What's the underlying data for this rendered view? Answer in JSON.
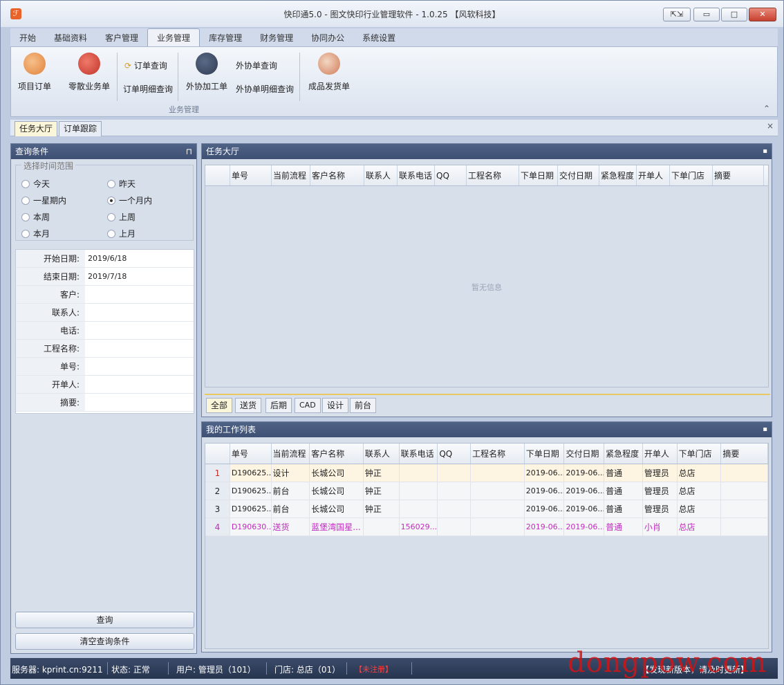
{
  "window": {
    "icon": "app-logo-icon",
    "title": "快印通5.0 - 图文快印行业管理软件 - 1.0.25 【风软科技】",
    "controls": {
      "restore_small": "⇱⇲",
      "minimize": "▭",
      "maximize": "□",
      "close": "✕"
    }
  },
  "menu": {
    "tabs": [
      "开始",
      "基础资料",
      "客户管理",
      "业务管理",
      "库存管理",
      "财务管理",
      "协同办公",
      "系统设置"
    ],
    "active": "业务管理"
  },
  "ribbon": {
    "project_order": "项目订单",
    "retail_order": "零散业务单",
    "order_query": "订单查询",
    "order_detail_query": "订单明细查询",
    "outsourcing": "外协加工单",
    "outsource_query": "外协单查询",
    "outsource_detail_query": "外协单明细查询",
    "shipping": "成品发货单",
    "group_label": "业务管理",
    "collapse": "⌃"
  },
  "doc_tabs": {
    "task_hall": "任务大厅",
    "order_tracking": "订单跟踪",
    "close": "×"
  },
  "left": {
    "header": "查询条件",
    "pin": "⊓",
    "range_legend": "选择时间范围",
    "radios": [
      "今天",
      "昨天",
      "一星期内",
      "一个月内",
      "本周",
      "上周",
      "本月",
      "上月"
    ],
    "selected": "一个月内",
    "fields": [
      {
        "label": "开始日期:",
        "value": "2019/6/18"
      },
      {
        "label": "结束日期:",
        "value": "2019/7/18"
      },
      {
        "label": "客户:",
        "value": ""
      },
      {
        "label": "联系人:",
        "value": ""
      },
      {
        "label": "电话:",
        "value": ""
      },
      {
        "label": "工程名称:",
        "value": ""
      },
      {
        "label": "单号:",
        "value": ""
      },
      {
        "label": "开单人:",
        "value": ""
      },
      {
        "label": "摘要:",
        "value": ""
      }
    ],
    "query_button": "查询",
    "clear_button": "清空查询条件"
  },
  "task_hall": {
    "header": "任务大厅",
    "max": "▪",
    "columns": [
      "单号",
      "当前流程",
      "客户名称",
      "联系人",
      "联系电话",
      "QQ",
      "工程名称",
      "下单日期",
      "交付日期",
      "紧急程度",
      "开单人",
      "下单门店",
      "摘要"
    ],
    "empty_text": "暂无信息",
    "filter_tabs": [
      "全部",
      "送货",
      "后期",
      "CAD",
      "设计",
      "前台"
    ],
    "active_filter": "全部"
  },
  "work_list": {
    "header": "我的工作列表",
    "max": "▪",
    "columns": [
      "单号",
      "当前流程",
      "客户名称",
      "联系人",
      "联系电话",
      "QQ",
      "工程名称",
      "下单日期",
      "交付日期",
      "紧急程度",
      "开单人",
      "下单门店",
      "摘要"
    ],
    "rows": [
      {
        "n": "1",
        "cells": [
          "D190625...",
          "设计",
          "长城公司",
          "钟正",
          "",
          "",
          "",
          "2019-06...",
          "2019-06...",
          "普通",
          "管理员",
          "总店",
          ""
        ]
      },
      {
        "n": "2",
        "cells": [
          "D190625...",
          "前台",
          "长城公司",
          "钟正",
          "",
          "",
          "",
          "2019-06...",
          "2019-06...",
          "普通",
          "管理员",
          "总店",
          ""
        ]
      },
      {
        "n": "3",
        "cells": [
          "D190625...",
          "前台",
          "长城公司",
          "钟正",
          "",
          "",
          "",
          "2019-06...",
          "2019-06...",
          "普通",
          "管理员",
          "总店",
          ""
        ]
      },
      {
        "n": "4",
        "cells": [
          "D190630...",
          "送货",
          "蓝堡湾国星...",
          "",
          "156029...",
          "",
          "",
          "2019-06...",
          "2019-06...",
          "普通",
          "小肖",
          "总店",
          ""
        ]
      }
    ]
  },
  "status": {
    "server": "服务器: kprint.cn:9211",
    "state": "状态: 正常",
    "user": "用户: 管理员（101）",
    "store": "门店: 总店（01）",
    "badge": "【未注册】",
    "update": "【发现新版本，请及时更新】"
  },
  "watermark": "dongpow.com",
  "colors": {
    "header_bg": "#45577a",
    "pink_row": "#c22ac0",
    "row1_number": "#c0302a",
    "watermark": "#d21414"
  }
}
